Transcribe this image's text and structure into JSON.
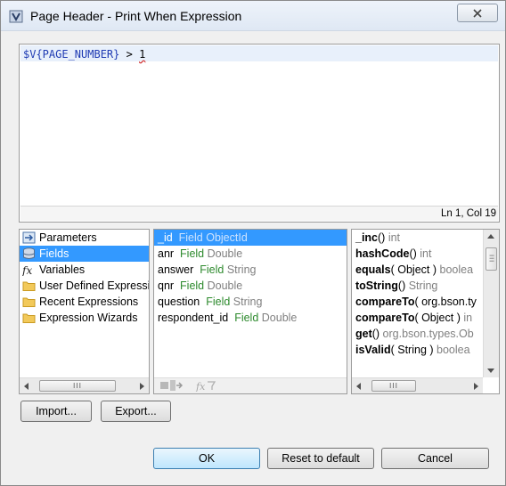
{
  "window": {
    "title": "Page Header - Print When Expression",
    "close_icon": "close-icon"
  },
  "editor": {
    "expression_var": "$V{PAGE_NUMBER}",
    "expression_op": " > ",
    "expression_num": "1",
    "cursor_position": "Ln 1, Col 19"
  },
  "categories": [
    {
      "label": "Parameters",
      "icon": "parameters-icon"
    },
    {
      "label": "Fields",
      "icon": "fields-icon",
      "selected": true
    },
    {
      "label": "Variables",
      "icon": "fx-icon"
    },
    {
      "label": "User Defined Expressi",
      "icon": "folder-icon"
    },
    {
      "label": "Recent Expressions",
      "icon": "folder-icon"
    },
    {
      "label": "Expression Wizards",
      "icon": "folder-icon"
    }
  ],
  "fields": [
    {
      "name": "_id",
      "kind": "Field",
      "type": "ObjectId",
      "selected": true
    },
    {
      "name": "anr",
      "kind": "Field",
      "type": "Double"
    },
    {
      "name": "answer",
      "kind": "Field",
      "type": "String"
    },
    {
      "name": "qnr",
      "kind": "Field",
      "type": "Double"
    },
    {
      "name": "question",
      "kind": "Field",
      "type": "String"
    },
    {
      "name": "respondent_id",
      "kind": "Field",
      "type": "Double"
    }
  ],
  "methods": [
    {
      "name": "_inc",
      "sig": "()",
      "ret": " int"
    },
    {
      "name": "hashCode",
      "sig": "()",
      "ret": " int"
    },
    {
      "name": "equals",
      "sig": "( Object )",
      "ret": " boolea"
    },
    {
      "name": "toString",
      "sig": "()",
      "ret": " String"
    },
    {
      "name": "compareTo",
      "sig": "( org.bson.ty",
      "ret": ""
    },
    {
      "name": "compareTo",
      "sig": "( Object )",
      "ret": " in"
    },
    {
      "name": "get",
      "sig": "()",
      "ret": " org.bson.types.Ob"
    },
    {
      "name": "isValid",
      "sig": "( String )",
      "ret": " boolea"
    }
  ],
  "buttons": {
    "import": "Import...",
    "export": "Export...",
    "ok": "OK",
    "reset": "Reset to default",
    "cancel": "Cancel"
  },
  "scroll": {
    "grip": "III"
  }
}
